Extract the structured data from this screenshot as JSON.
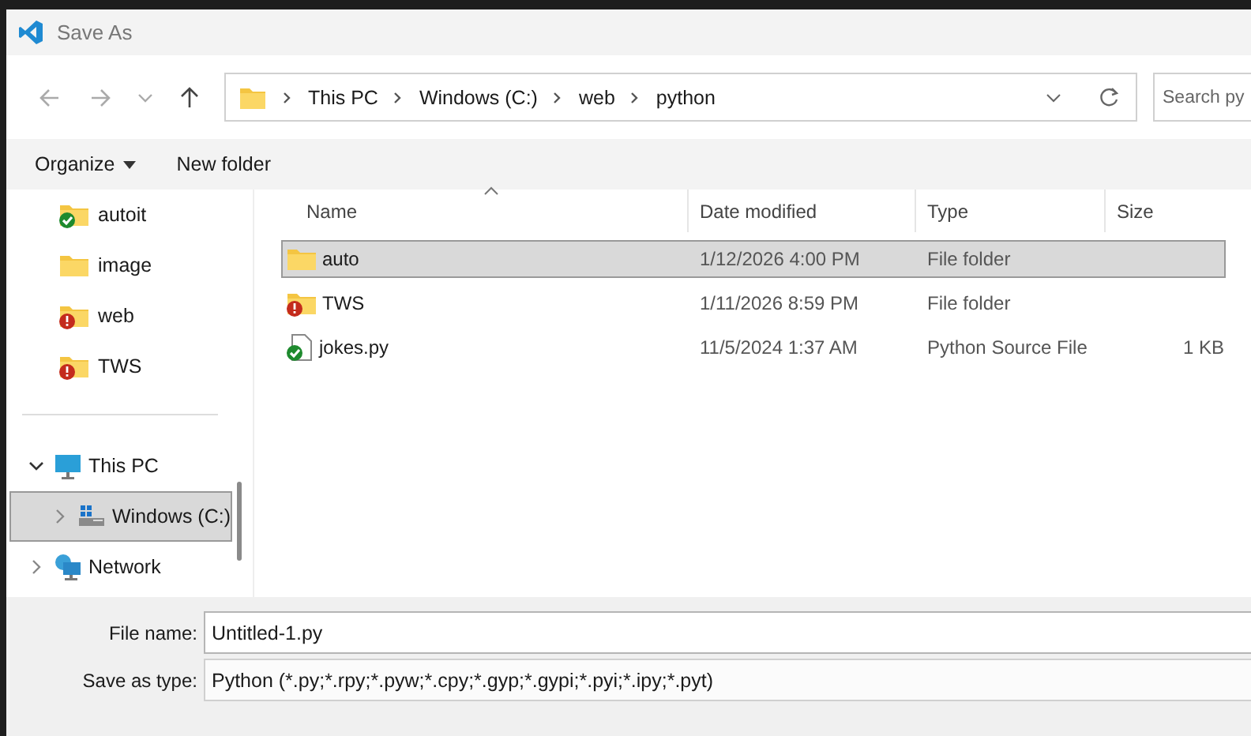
{
  "window": {
    "title": "Save As"
  },
  "address_bar": {
    "crumbs": [
      "This PC",
      "Windows (C:)",
      "web",
      "python"
    ]
  },
  "search": {
    "placeholder": "Search py"
  },
  "commands": [
    {
      "label": "Organize",
      "dropdown": true
    },
    {
      "label": "New folder",
      "dropdown": false
    }
  ],
  "sidebar": {
    "quick_access": [
      {
        "label": "autoit",
        "kind": "synced"
      },
      {
        "label": "image",
        "kind": "plain"
      },
      {
        "label": "web",
        "kind": "error"
      },
      {
        "label": "TWS",
        "kind": "error"
      }
    ],
    "tree": [
      {
        "label": "This PC",
        "kind": "pc",
        "expanded": true,
        "selected": false,
        "children": [
          {
            "label": "Windows (C:)",
            "kind": "drive",
            "expanded": false,
            "selected": true
          }
        ]
      },
      {
        "label": "Network",
        "kind": "network",
        "expanded": false,
        "selected": false
      }
    ]
  },
  "table": {
    "columns": [
      "Name",
      "Date modified",
      "Type",
      "Size"
    ],
    "rows": [
      {
        "kind": "folder",
        "selected": true,
        "cells": [
          "auto",
          "1/12/2026 4:00 PM",
          "File folder",
          ""
        ]
      },
      {
        "kind": "folder-error",
        "selected": false,
        "cells": [
          "TWS",
          "1/11/2026 8:59 PM",
          "File folder",
          ""
        ]
      },
      {
        "kind": "file-synced",
        "selected": false,
        "cells": [
          "jokes.py",
          "11/5/2024 1:37 AM",
          "Python Source File",
          "1 KB"
        ]
      }
    ]
  },
  "form": {
    "file_name": {
      "label": "File name:",
      "value": "Untitled-1.py"
    },
    "save_type": {
      "label": "Save as type:",
      "value": "Python (*.py;*.rpy;*.pyw;*.cpy;*.gyp;*.gypi;*.pyi;*.ipy;*.pyt)"
    }
  }
}
